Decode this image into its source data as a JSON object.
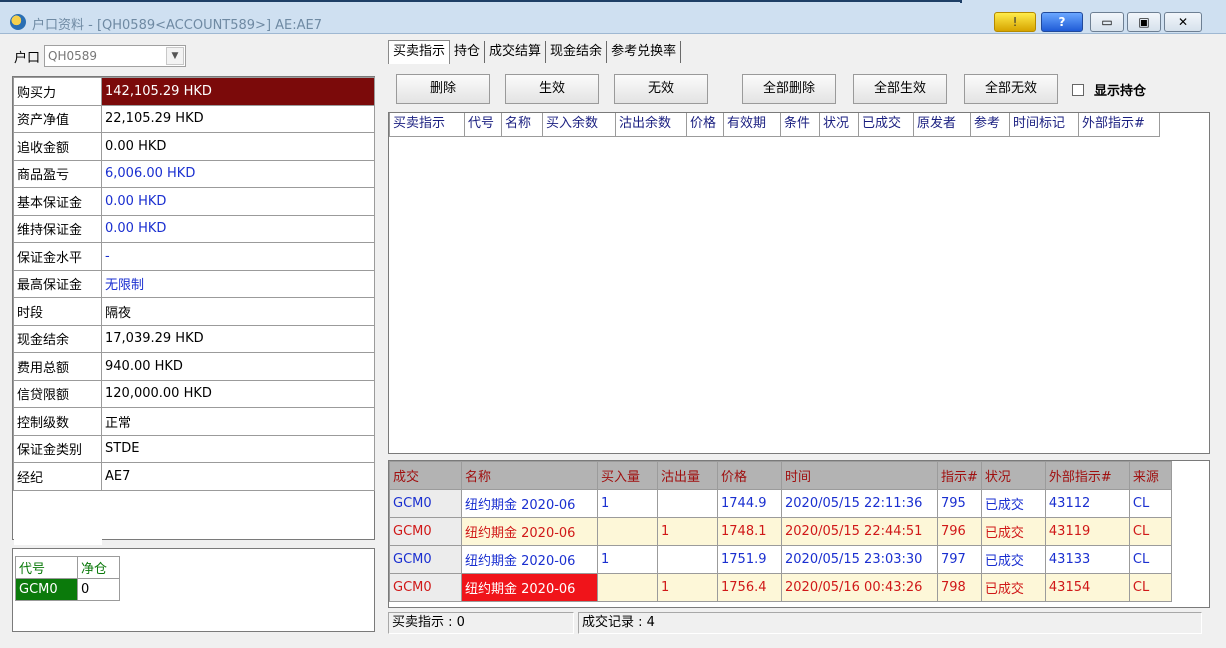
{
  "window": {
    "title": "户口资料 - [QH0589<ACCOUNT589>] AE:AE7",
    "warn_label": "!",
    "help_label": "?",
    "min_label": "▭",
    "max_label": "▣",
    "close_label": "✕"
  },
  "account": {
    "label": "户口",
    "value": "QH0589"
  },
  "info_rows": [
    {
      "key": "购买力",
      "value": "142,105.29 HKD"
    },
    {
      "key": "资产净值",
      "value": "22,105.29 HKD"
    },
    {
      "key": "追收金额",
      "value": "0.00 HKD"
    },
    {
      "key": "商品盈亏",
      "value": "6,006.00 HKD"
    },
    {
      "key": "基本保证金",
      "value": "0.00 HKD"
    },
    {
      "key": "维持保证金",
      "value": "0.00 HKD"
    },
    {
      "key": "保证金水平",
      "value": "-"
    },
    {
      "key": "最高保证金",
      "value": "无限制"
    },
    {
      "key": "时段",
      "value": "隔夜"
    },
    {
      "key": "现金结余",
      "value": "17,039.29 HKD"
    },
    {
      "key": "费用总额",
      "value": "940.00 HKD"
    },
    {
      "key": "信贷限额",
      "value": "120,000.00 HKD"
    },
    {
      "key": "控制级数",
      "value": "正常"
    },
    {
      "key": "保证金类别",
      "value": "STDE"
    },
    {
      "key": "经纪",
      "value": "AE7"
    }
  ],
  "positions": {
    "headers": [
      "代号",
      "净仓"
    ],
    "rows": [
      {
        "code": "GCM0",
        "net": "0"
      }
    ]
  },
  "tabs": [
    "买卖指示",
    "持仓",
    "成交结算",
    "现金结余",
    "参考兑换率"
  ],
  "buttons": {
    "delete": "删除",
    "activate": "生效",
    "deactivate": "无效",
    "delete_all": "全部删除",
    "activate_all": "全部生效",
    "deactivate_all": "全部无效",
    "show_positions": "显示持仓"
  },
  "order_columns": [
    "买卖指示",
    "代号",
    "名称",
    "买入余数",
    "沽出余数",
    "价格",
    "有效期",
    "条件",
    "状况",
    "已成交",
    "原发者",
    "参考",
    "时间标记",
    "外部指示#"
  ],
  "trades": {
    "headers": [
      "成交",
      "名称",
      "买入量",
      "沽出量",
      "价格",
      "时间",
      "指示#",
      "状况",
      "外部指示#",
      "来源"
    ],
    "rows": [
      {
        "code": "GCM0",
        "name": "纽约期金 2020-06",
        "buy": "1",
        "sell": "",
        "price": "1744.9",
        "time": "2020/05/15 22:11:36",
        "order": "795",
        "status": "已成交",
        "ext": "43112",
        "source": "CL"
      },
      {
        "code": "GCM0",
        "name": "纽约期金 2020-06",
        "buy": "",
        "sell": "1",
        "price": "1748.1",
        "time": "2020/05/15 22:44:51",
        "order": "796",
        "status": "已成交",
        "ext": "43119",
        "source": "CL"
      },
      {
        "code": "GCM0",
        "name": "纽约期金 2020-06",
        "buy": "1",
        "sell": "",
        "price": "1751.9",
        "time": "2020/05/15 23:03:30",
        "order": "797",
        "status": "已成交",
        "ext": "43133",
        "source": "CL"
      },
      {
        "code": "GCM0",
        "name": "纽约期金 2020-06",
        "buy": "",
        "sell": "1",
        "price": "1756.4",
        "time": "2020/05/16 00:43:26",
        "order": "798",
        "status": "已成交",
        "ext": "43154",
        "source": "CL"
      }
    ]
  },
  "status": {
    "orders": "买卖指示 : 0",
    "trades": "成交记录 : 4"
  }
}
